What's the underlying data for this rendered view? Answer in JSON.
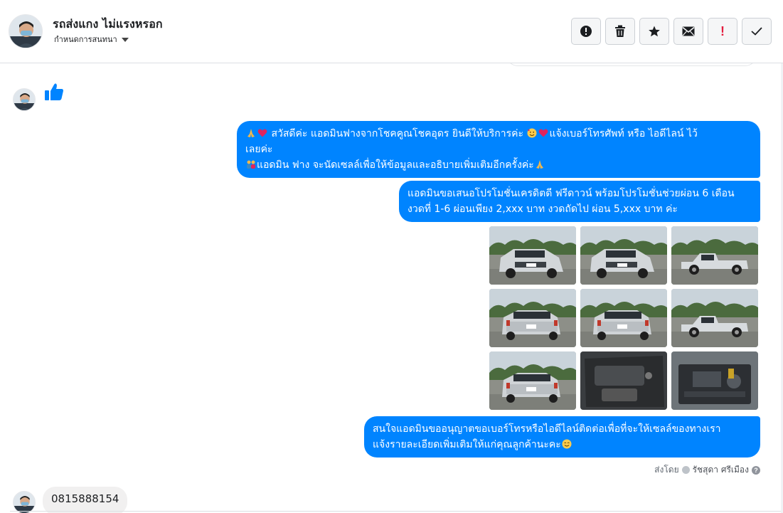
{
  "header": {
    "contact_name": "รถส่งแกง ไม่แรงหรอก",
    "subtitle": "กำหนดการสนทนา",
    "toolbar": [
      {
        "name": "report-icon",
        "label": ""
      },
      {
        "name": "trash-icon",
        "label": ""
      },
      {
        "name": "star-icon",
        "label": ""
      },
      {
        "name": "envelope-icon",
        "label": ""
      },
      {
        "name": "important-icon",
        "label": "!"
      },
      {
        "name": "check-icon",
        "label": ""
      }
    ]
  },
  "messages": {
    "b1_line1": "สวัสดีค่ะ แอดมินฟางจากโชคคูณโชคอุดร ยินดีให้บริการค่ะ",
    "b1_line1b": "แจ้งเบอร์โทรศัพท์ หรือ ไอดีไลน์  ไว้",
    "b1_line2": "เลยค่ะ",
    "b1_line3": "แอดมิน ฟาง จะนัดเซลล์เพื่อให้ข้อมูลและอธิบายเพิ่มเติมอีกครั้งค่ะ",
    "b2_line1": "แอดมินขอเสนอโปรโมชั่นเครดิตดี ฟรีดาวน์ พร้อมโปรโมชั่นช่วยผ่อน 6 เดือน",
    "b2_line2": "งวดที่ 1-6 ผ่อนเพียง 2,xxx บาท งวดถัดไป ผ่อน 5,xxx บาท ค่ะ",
    "b3_line1": "สนใจแอดมินขออนุญาตขอเบอร์โทรหรือไอดีไลน์ติดต่อเพื่อที่จะให้เซลล์ของทางเรา",
    "b3_line2": "แจ้งรายละเอียดเพิ่มเติมให้แก่คุณลูกค้านะคะ",
    "sent_by_label": "ส่งโดย",
    "sent_by_name": "รัชสุดา ศรีเมือง",
    "incoming_phone": "0815888154"
  },
  "photos": [
    {
      "name": "photo-truck-front-left"
    },
    {
      "name": "photo-truck-front"
    },
    {
      "name": "photo-truck-side-left"
    },
    {
      "name": "photo-truck-rear-left"
    },
    {
      "name": "photo-truck-rear"
    },
    {
      "name": "photo-truck-side-right"
    },
    {
      "name": "photo-truck-rear-left-2"
    },
    {
      "name": "photo-door-interior"
    },
    {
      "name": "photo-engine-bay"
    }
  ],
  "colors": {
    "accent": "#0084ff",
    "incoming_bubble": "#f1f0f0",
    "important": "#e41e3f"
  }
}
